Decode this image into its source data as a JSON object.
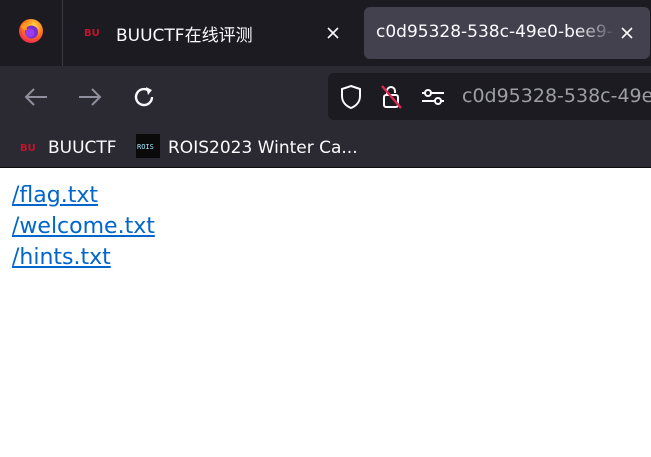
{
  "tabs": [
    {
      "title": "BUUCTF在线评测"
    },
    {
      "title": "c0d95328-538c-49e0-bee9-",
      "active": true
    }
  ],
  "urlbar": {
    "text": "c0d95328-538c-49e0"
  },
  "bookmarks": [
    {
      "label": "BUUCTF",
      "icon": "buuctf-favicon"
    },
    {
      "label": "ROIS2023 Winter Ca...",
      "icon": "rois-favicon",
      "icon_text": "ROIS"
    }
  ],
  "links": [
    {
      "text": "/flag.txt"
    },
    {
      "text": "/welcome.txt"
    },
    {
      "text": "/hints.txt"
    }
  ],
  "colors": {
    "tabbar": "#1c1b22",
    "toolbar": "#2b2a33",
    "active_tab": "#42414d",
    "link": "#0066cc"
  }
}
